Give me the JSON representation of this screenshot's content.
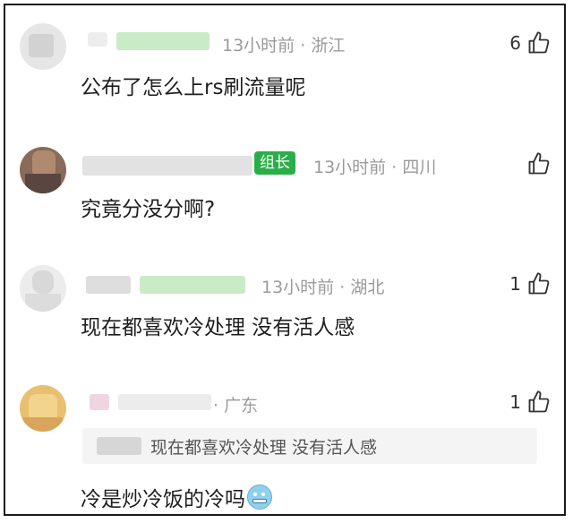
{
  "comments": [
    {
      "time": "13小时前",
      "location": "浙江",
      "text": "公布了怎么上rs刷流量呢",
      "likes": "6"
    },
    {
      "badge": "组长",
      "time": "13小时前",
      "location": "四川",
      "text": "究竟分没分啊?",
      "likes": ""
    },
    {
      "time": "13小时前",
      "location": "湖北",
      "text": "现在都喜欢冷处理  没有活人感",
      "likes": "1"
    },
    {
      "location": "广东",
      "quoted_text": "现在都喜欢冷处理 没有活人感",
      "text": "冷是炒冷饭的冷吗",
      "likes": "1",
      "emoji": "cold-face-emoji"
    }
  ],
  "separator": "·",
  "colors": {
    "meta": "#9a9a9a",
    "badge": "#2aae4a",
    "blur_green": "#c9ebc6"
  }
}
